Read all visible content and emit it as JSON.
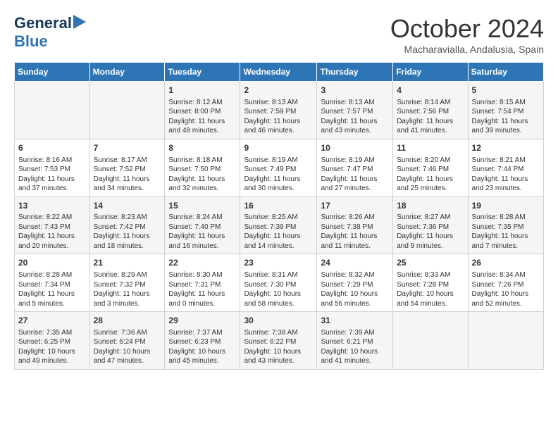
{
  "header": {
    "logo_general": "General",
    "logo_blue": "Blue",
    "month": "October 2024",
    "location": "Macharavialla, Andalusia, Spain"
  },
  "days_of_week": [
    "Sunday",
    "Monday",
    "Tuesday",
    "Wednesday",
    "Thursday",
    "Friday",
    "Saturday"
  ],
  "weeks": [
    [
      {
        "day": "",
        "info": ""
      },
      {
        "day": "",
        "info": ""
      },
      {
        "day": "1",
        "info": "Sunrise: 8:12 AM\nSunset: 8:00 PM\nDaylight: 11 hours and 48 minutes."
      },
      {
        "day": "2",
        "info": "Sunrise: 8:13 AM\nSunset: 7:59 PM\nDaylight: 11 hours and 46 minutes."
      },
      {
        "day": "3",
        "info": "Sunrise: 8:13 AM\nSunset: 7:57 PM\nDaylight: 11 hours and 43 minutes."
      },
      {
        "day": "4",
        "info": "Sunrise: 8:14 AM\nSunset: 7:56 PM\nDaylight: 11 hours and 41 minutes."
      },
      {
        "day": "5",
        "info": "Sunrise: 8:15 AM\nSunset: 7:54 PM\nDaylight: 11 hours and 39 minutes."
      }
    ],
    [
      {
        "day": "6",
        "info": "Sunrise: 8:16 AM\nSunset: 7:53 PM\nDaylight: 11 hours and 37 minutes."
      },
      {
        "day": "7",
        "info": "Sunrise: 8:17 AM\nSunset: 7:52 PM\nDaylight: 11 hours and 34 minutes."
      },
      {
        "day": "8",
        "info": "Sunrise: 8:18 AM\nSunset: 7:50 PM\nDaylight: 11 hours and 32 minutes."
      },
      {
        "day": "9",
        "info": "Sunrise: 8:19 AM\nSunset: 7:49 PM\nDaylight: 11 hours and 30 minutes."
      },
      {
        "day": "10",
        "info": "Sunrise: 8:19 AM\nSunset: 7:47 PM\nDaylight: 11 hours and 27 minutes."
      },
      {
        "day": "11",
        "info": "Sunrise: 8:20 AM\nSunset: 7:46 PM\nDaylight: 11 hours and 25 minutes."
      },
      {
        "day": "12",
        "info": "Sunrise: 8:21 AM\nSunset: 7:44 PM\nDaylight: 11 hours and 23 minutes."
      }
    ],
    [
      {
        "day": "13",
        "info": "Sunrise: 8:22 AM\nSunset: 7:43 PM\nDaylight: 11 hours and 20 minutes."
      },
      {
        "day": "14",
        "info": "Sunrise: 8:23 AM\nSunset: 7:42 PM\nDaylight: 11 hours and 18 minutes."
      },
      {
        "day": "15",
        "info": "Sunrise: 8:24 AM\nSunset: 7:40 PM\nDaylight: 11 hours and 16 minutes."
      },
      {
        "day": "16",
        "info": "Sunrise: 8:25 AM\nSunset: 7:39 PM\nDaylight: 11 hours and 14 minutes."
      },
      {
        "day": "17",
        "info": "Sunrise: 8:26 AM\nSunset: 7:38 PM\nDaylight: 11 hours and 11 minutes."
      },
      {
        "day": "18",
        "info": "Sunrise: 8:27 AM\nSunset: 7:36 PM\nDaylight: 11 hours and 9 minutes."
      },
      {
        "day": "19",
        "info": "Sunrise: 8:28 AM\nSunset: 7:35 PM\nDaylight: 11 hours and 7 minutes."
      }
    ],
    [
      {
        "day": "20",
        "info": "Sunrise: 8:28 AM\nSunset: 7:34 PM\nDaylight: 11 hours and 5 minutes."
      },
      {
        "day": "21",
        "info": "Sunrise: 8:29 AM\nSunset: 7:32 PM\nDaylight: 11 hours and 3 minutes."
      },
      {
        "day": "22",
        "info": "Sunrise: 8:30 AM\nSunset: 7:31 PM\nDaylight: 11 hours and 0 minutes."
      },
      {
        "day": "23",
        "info": "Sunrise: 8:31 AM\nSunset: 7:30 PM\nDaylight: 10 hours and 58 minutes."
      },
      {
        "day": "24",
        "info": "Sunrise: 8:32 AM\nSunset: 7:29 PM\nDaylight: 10 hours and 56 minutes."
      },
      {
        "day": "25",
        "info": "Sunrise: 8:33 AM\nSunset: 7:28 PM\nDaylight: 10 hours and 54 minutes."
      },
      {
        "day": "26",
        "info": "Sunrise: 8:34 AM\nSunset: 7:26 PM\nDaylight: 10 hours and 52 minutes."
      }
    ],
    [
      {
        "day": "27",
        "info": "Sunrise: 7:35 AM\nSunset: 6:25 PM\nDaylight: 10 hours and 49 minutes."
      },
      {
        "day": "28",
        "info": "Sunrise: 7:36 AM\nSunset: 6:24 PM\nDaylight: 10 hours and 47 minutes."
      },
      {
        "day": "29",
        "info": "Sunrise: 7:37 AM\nSunset: 6:23 PM\nDaylight: 10 hours and 45 minutes."
      },
      {
        "day": "30",
        "info": "Sunrise: 7:38 AM\nSunset: 6:22 PM\nDaylight: 10 hours and 43 minutes."
      },
      {
        "day": "31",
        "info": "Sunrise: 7:39 AM\nSunset: 6:21 PM\nDaylight: 10 hours and 41 minutes."
      },
      {
        "day": "",
        "info": ""
      },
      {
        "day": "",
        "info": ""
      }
    ]
  ]
}
